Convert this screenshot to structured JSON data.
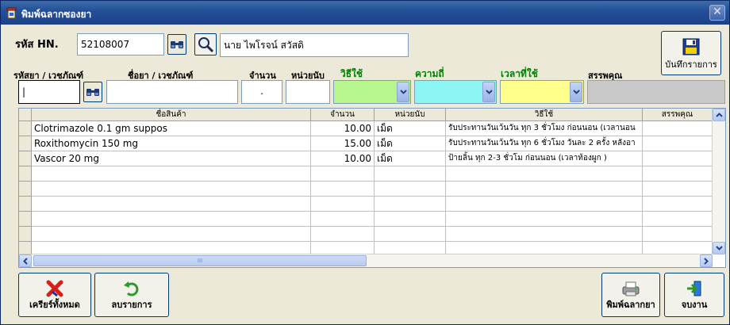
{
  "window": {
    "title": "พิมพ์ฉลากซองยา",
    "close_glyph": "✕"
  },
  "patient": {
    "hn_label": "รหัส HN.",
    "hn_value": "52108007",
    "name_value": "นาย ไพโรจน์ สวัสดิ"
  },
  "entry": {
    "code_label": "รหัสยา / เวชภัณฑ์",
    "name_label": "ชื่อยา / เวชภัณฑ์",
    "qty_label": "จำนวน",
    "unit_label": "หน่วยนับ",
    "usage_label": "วิธีใช้",
    "freq_label": "ความถี่",
    "time_label": "เวลาที่ใช้",
    "property_label": "สรรพคุณ",
    "code_value": "|",
    "qty_value": ".",
    "usage_color": "#b7f58f",
    "freq_color": "#8ef5f5",
    "time_color": "#ffff8c"
  },
  "toolbar": {
    "save_label": "บันทึกรายการ"
  },
  "table": {
    "headers": [
      "ชื่อสินค้า",
      "จำนวน",
      "หน่วยนับ",
      "วิธีใช้",
      "สรรพคุณ"
    ],
    "rows": [
      {
        "name": "Clotrimazole 0.1 gm  suppos",
        "qty": "10.00",
        "unit": "เม็ด",
        "usage": "รับประทานวันเว้นวัน ทุก 3 ชั่วโมง ก่อนนอน (เวลานอน",
        "property": ""
      },
      {
        "name": "Roxithomycin 150 mg",
        "qty": "15.00",
        "unit": "เม็ด",
        "usage": "รับประทานวันเว้นวัน ทุก 6 ชั่วโมง วันละ 2 ครั้ง หลังอา",
        "property": ""
      },
      {
        "name": "Vascor  20  mg",
        "qty": "10.00",
        "unit": "เม็ด",
        "usage": "ป้ายลิ้น ทุก 2-3 ชั่วโม ก่อนนอน (เวลาท้องผูก )",
        "property": ""
      }
    ],
    "empty_rows": 6,
    "scroll_grip": "III"
  },
  "footer": {
    "clear_all_label": "เครียร์ทั้งหมด",
    "delete_label": "ลบรายการ",
    "print_label": "พิมพ์ฉลากยา",
    "exit_label": "จบงาน"
  }
}
